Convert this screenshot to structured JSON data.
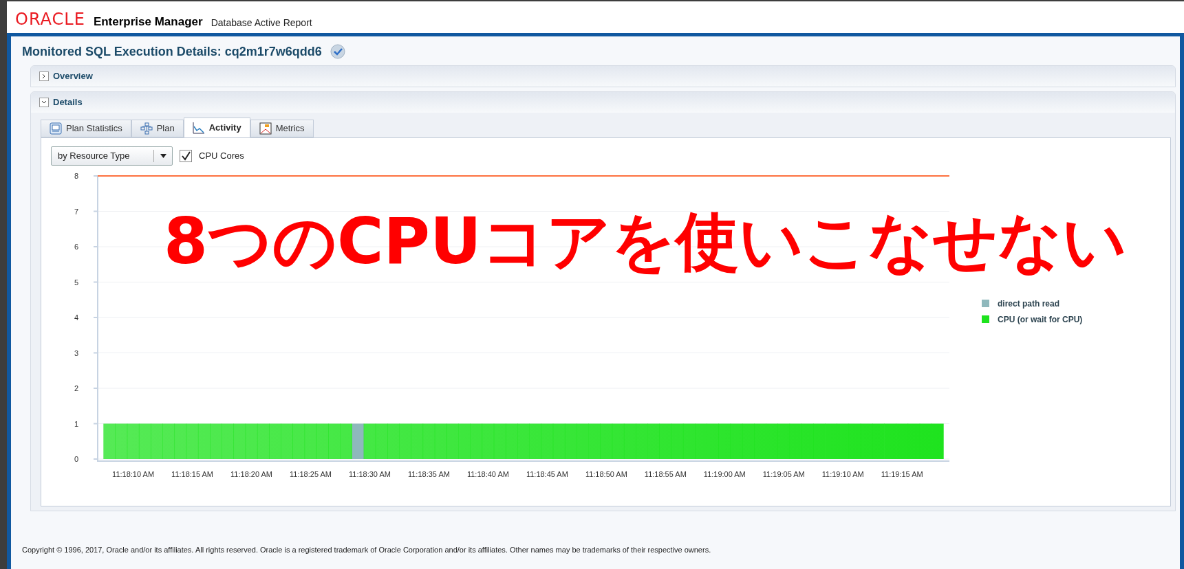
{
  "header": {
    "brand": "ORACLE",
    "product": "Enterprise Manager",
    "subtitle": "Database Active Report"
  },
  "page_title": "Monitored SQL Execution Details: cq2m1r7w6qdd6",
  "sections": [
    {
      "label": "Overview",
      "expanded": false
    },
    {
      "label": "Details",
      "expanded": true
    }
  ],
  "tabs": [
    {
      "label": "Plan Statistics",
      "kind": "table",
      "selected": false
    },
    {
      "label": "Plan",
      "kind": "tree",
      "selected": false
    },
    {
      "label": "Activity",
      "kind": "activity",
      "selected": true
    },
    {
      "label": "Metrics",
      "kind": "gauge",
      "selected": false
    }
  ],
  "group_by": {
    "value": "by Resource Type"
  },
  "cpu_cores": {
    "label": "CPU Cores",
    "checked": true
  },
  "chart_data": {
    "type": "bar",
    "stacked": true,
    "grid": true,
    "legend": "right",
    "ylim": [
      0,
      8
    ],
    "yticks": [
      0,
      1,
      2,
      3,
      4,
      5,
      6,
      7,
      8
    ],
    "categories": [
      null,
      null,
      "11:18:10 AM",
      null,
      null,
      null,
      null,
      "11:18:15 AM",
      null,
      null,
      null,
      null,
      "11:18:20 AM",
      null,
      null,
      null,
      null,
      "11:18:25 AM",
      null,
      null,
      null,
      null,
      "11:18:30 AM",
      null,
      null,
      null,
      null,
      "11:18:35 AM",
      null,
      null,
      null,
      null,
      "11:18:40 AM",
      null,
      null,
      null,
      null,
      "11:18:45 AM",
      null,
      null,
      null,
      null,
      "11:18:50 AM",
      null,
      null,
      null,
      null,
      "11:18:55 AM",
      null,
      null,
      null,
      null,
      "11:19:00 AM",
      null,
      null,
      null,
      null,
      "11:19:05 AM",
      null,
      null,
      null,
      null,
      "11:19:10 AM",
      null,
      null,
      null,
      null,
      "11:19:15 AM",
      null,
      null,
      null
    ],
    "series": [
      {
        "name": "direct path read",
        "color": "#8fb8bc",
        "values": [
          0,
          0,
          0,
          0,
          0,
          0,
          0,
          0,
          0,
          0,
          0,
          0,
          0,
          0,
          0,
          0,
          0,
          0,
          0,
          0,
          0,
          1,
          0,
          0,
          0,
          0,
          0,
          0,
          0,
          0,
          0,
          0,
          0,
          0,
          0,
          0,
          0,
          0,
          0,
          0,
          0,
          0,
          0,
          0,
          0,
          0,
          0,
          0,
          0,
          0,
          0,
          0,
          0,
          0,
          0,
          0,
          0,
          0,
          0,
          0,
          0,
          0,
          0,
          0,
          0,
          0,
          0,
          0,
          0,
          0,
          0
        ]
      },
      {
        "name": "CPU (or wait for CPU)",
        "color": "#1ee31e",
        "values": [
          1,
          1,
          1,
          1,
          1,
          1,
          1,
          1,
          1,
          1,
          1,
          1,
          1,
          1,
          1,
          1,
          1,
          1,
          1,
          1,
          1,
          0,
          1,
          1,
          1,
          1,
          1,
          1,
          1,
          1,
          1,
          1,
          1,
          1,
          1,
          1,
          1,
          1,
          1,
          1,
          1,
          1,
          1,
          1,
          1,
          1,
          1,
          1,
          1,
          1,
          1,
          1,
          1,
          1,
          1,
          1,
          1,
          1,
          1,
          1,
          1,
          1,
          1,
          1,
          1,
          1,
          1,
          1,
          1,
          1,
          1
        ]
      }
    ],
    "ref_lines": [
      {
        "axis": "y",
        "value": 8
      }
    ]
  },
  "overlay_text": "8つのCPUコアを使いこなせない",
  "footer": "Copyright © 1996, 2017, Oracle and/or its affiliates. All rights reserved. Oracle is a registered trademark of Oracle Corporation and/or its affiliates. Other names may be trademarks of their respective owners."
}
